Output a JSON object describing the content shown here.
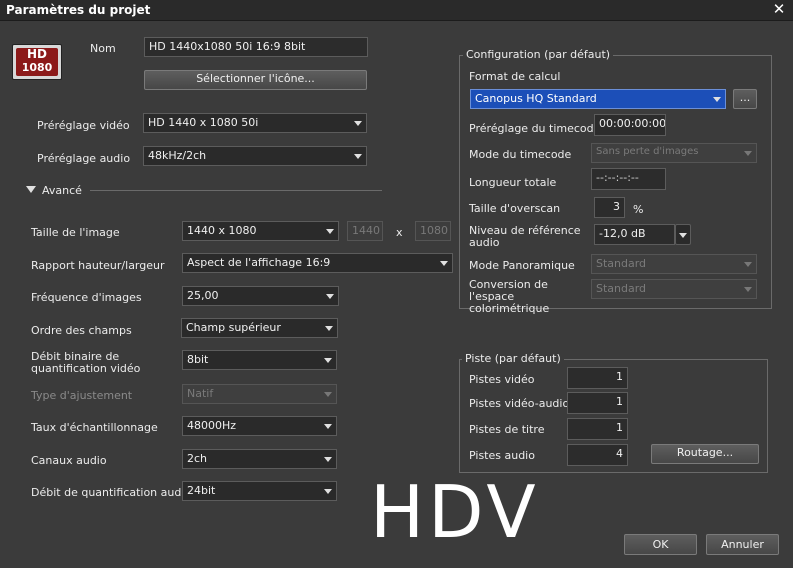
{
  "window": {
    "title": "Paramètres du projet",
    "close_glyph": "✕"
  },
  "icon": {
    "top": "HD",
    "bottom": "1080"
  },
  "left": {
    "name_label": "Nom",
    "name_value": "HD 1440x1080 50i 16:9 8bit",
    "select_icon_button": "Sélectionner l'icône...",
    "video_preset_label": "Préréglage vidéo",
    "video_preset_value": "HD 1440 x 1080 50i",
    "audio_preset_label": "Préréglage audio",
    "audio_preset_value": "48kHz/2ch",
    "advanced_label": "Avancé",
    "image_size_label": "Taille de l'image",
    "image_size_value": "1440 x 1080",
    "image_width": "1440",
    "image_x": "x",
    "image_height": "1080",
    "aspect_label": "Rapport hauteur/largeur",
    "aspect_value": "Aspect de l'affichage 16:9",
    "framerate_label": "Fréquence d'images",
    "framerate_value": "25,00",
    "field_order_label": "Ordre des champs",
    "field_order_value": "Champ supérieur",
    "bitrate_label": "Débit binaire de quantification vidéo",
    "bitrate_value": "8bit",
    "adjust_label": "Type d'ajustement",
    "adjust_value": "Natif",
    "sample_rate_label": "Taux d'échantillonnage",
    "sample_rate_value": "48000Hz",
    "audio_channels_label": "Canaux audio",
    "audio_channels_value": "2ch",
    "audio_quant_label": "Débit de quantification audio",
    "audio_quant_value": "24bit"
  },
  "config": {
    "title": "Configuration (par défaut)",
    "render_format_label": "Format de calcul",
    "render_format_value": "Canopus HQ Standard",
    "browse_button": "...",
    "timecode_preset_label": "Préréglage du timecode",
    "timecode_preset_value": "00:00:00:00",
    "timecode_mode_label": "Mode du timecode",
    "timecode_mode_value": "Sans perte d'images",
    "total_length_label": "Longueur totale",
    "total_length_value": "--:--:--:--",
    "overscan_label": "Taille d'overscan",
    "overscan_value": "3",
    "overscan_unit": "%",
    "audio_ref_label": "Niveau de référence audio",
    "audio_ref_value": "-12,0 dB",
    "pan_mode_label": "Mode Panoramique",
    "pan_mode_value": "Standard",
    "colorspace_label": "Conversion de l'espace colorimétrique",
    "colorspace_value": "Standard"
  },
  "track": {
    "title": "Piste (par défaut)",
    "video_label": "Pistes vidéo",
    "video_value": "1",
    "video_audio_label": "Pistes vidéo-audio",
    "video_audio_value": "1",
    "title_label": "Pistes de titre",
    "title_value": "1",
    "audio_label": "Pistes audio",
    "audio_value": "4",
    "routing_button": "Routage..."
  },
  "handwritten": "HDV",
  "footer": {
    "ok": "OK",
    "cancel": "Annuler"
  }
}
